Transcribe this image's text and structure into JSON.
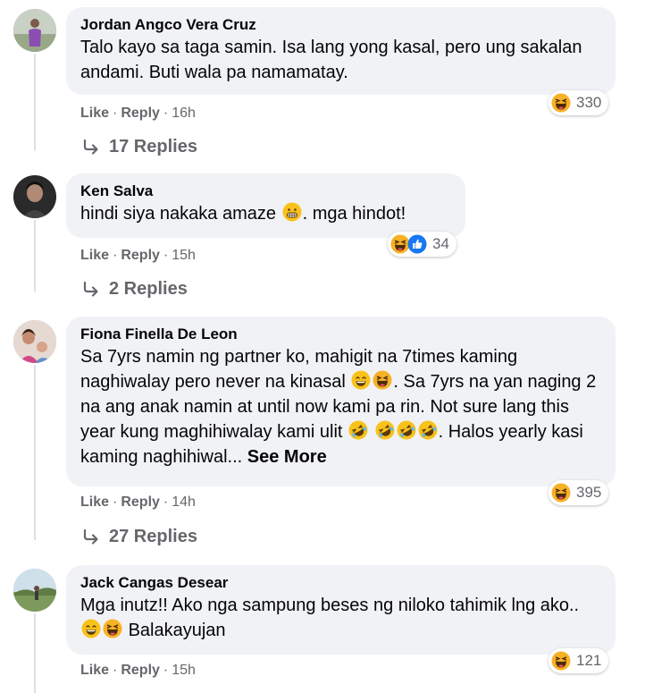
{
  "comments": [
    {
      "author": "Jordan Angco Vera Cruz",
      "text_1": "Talo kayo sa taga samin. Isa lang yong kasal, pero ung sakalan andami. Buti wala pa namamatay.",
      "reaction_count": "330",
      "reaction_icons": [
        "haha"
      ],
      "like_label": "Like",
      "reply_label": "Reply",
      "time": "16h",
      "replies_label": "17 Replies"
    },
    {
      "author": "Ken Salva",
      "text_1": "hindi siya nakaka amaze",
      "text_2": ". mga hindot!",
      "reaction_count": "34",
      "reaction_icons": [
        "haha",
        "like"
      ],
      "like_label": "Like",
      "reply_label": "Reply",
      "time": "15h",
      "replies_label": "2 Replies"
    },
    {
      "author": "Fiona Finella De Leon",
      "text_1": "Sa 7yrs namin ng partner ko, mahigit na 7times kaming naghiwalay pero never na kinasal",
      "text_2": ". Sa 7yrs na yan naging 2 na ang anak namin at until now kami pa rin. Not sure lang this year kung maghihiwalay kami ulit",
      "text_3": ". Halos yearly kasi kaming naghihiwal...",
      "see_more": "See More",
      "reaction_count": "395",
      "reaction_icons": [
        "haha"
      ],
      "like_label": "Like",
      "reply_label": "Reply",
      "time": "14h",
      "replies_label": "27 Replies"
    },
    {
      "author": "Jack Cangas Desear",
      "text_1": "Mga inutz!! Ako nga sampung beses ng niloko tahimik lng ako..",
      "text_2": "Balakayujan",
      "reaction_count": "121",
      "reaction_icons": [
        "haha"
      ],
      "like_label": "Like",
      "reply_label": "Reply",
      "time": "15h"
    }
  ],
  "colors": {
    "bubble": "#f0f2f5",
    "muted": "#65676b",
    "haha": "#f7b125",
    "like": "#1877f2"
  }
}
